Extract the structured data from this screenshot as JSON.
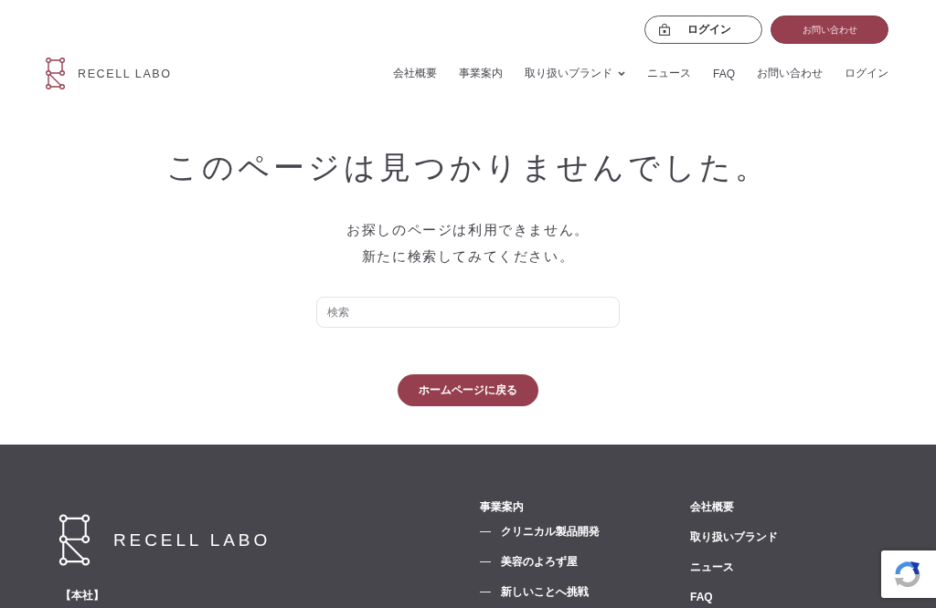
{
  "header": {
    "logo": {
      "text": "RECELL LABO"
    },
    "top_buttons": [
      {
        "label": "ログイン",
        "kind": "outline"
      },
      {
        "label": "お問い合わせ",
        "kind": "filled"
      }
    ],
    "nav": [
      {
        "label": "会社概要",
        "has_dropdown": false
      },
      {
        "label": "事業案内",
        "has_dropdown": false
      },
      {
        "label": "取り扱いブランド",
        "has_dropdown": true
      },
      {
        "label": "ニュース",
        "has_dropdown": false
      },
      {
        "label": "FAQ",
        "has_dropdown": false
      },
      {
        "label": "お問い合わせ",
        "has_dropdown": false
      },
      {
        "label": "ログイン",
        "has_dropdown": false
      }
    ]
  },
  "main": {
    "title": "このページは見つかりませんでした。",
    "message_lines": [
      "お探しのページは利用できません。",
      "新たに検索してみてください。"
    ],
    "search": {
      "placeholder": "検索"
    },
    "home_button": "ホームページに戻る"
  },
  "footer": {
    "logo": {
      "text": "RECELL LABO"
    },
    "office_label": "【本社】",
    "services": {
      "heading": "事業案内",
      "items": [
        {
          "marker": "—",
          "label": "クリニカル製品開発"
        },
        {
          "marker": "—",
          "label": "美容のよろず屋"
        },
        {
          "marker": "—",
          "label": "新しいことへ挑戦"
        }
      ]
    },
    "links": [
      "会社概要",
      "取り扱いブランド",
      "ニュース",
      "FAQ"
    ]
  }
}
